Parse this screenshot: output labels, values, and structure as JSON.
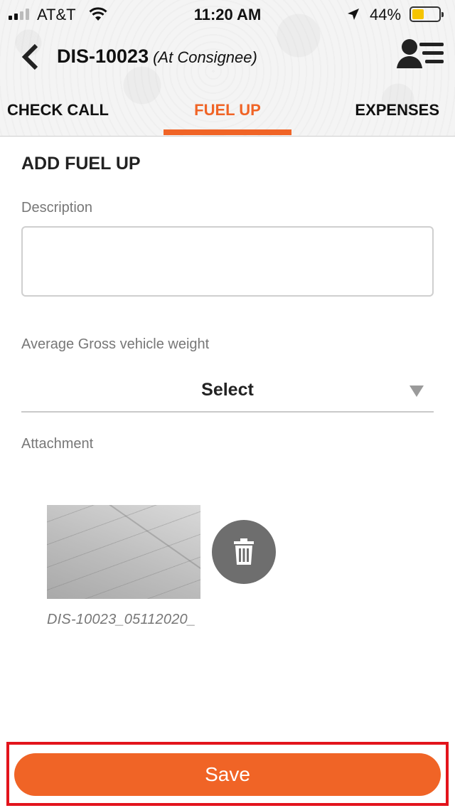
{
  "status_bar": {
    "carrier": "AT&T",
    "time": "11:20 AM",
    "battery_percent": "44%",
    "battery_level": 0.44,
    "battery_color": "#f5c400"
  },
  "nav": {
    "title": "DIS-10023",
    "subtitle": "(At Consignee)",
    "back_icon": "chevron-left-icon",
    "profile_icon": "user-list-icon"
  },
  "tabs": [
    {
      "label": "CHECK CALL",
      "active": false
    },
    {
      "label": "FUEL UP",
      "active": true
    },
    {
      "label": "EXPENSES",
      "active": false
    }
  ],
  "form": {
    "section_title": "ADD FUEL UP",
    "description": {
      "label": "Description",
      "value": "",
      "placeholder": ""
    },
    "weight": {
      "label": "Average Gross vehicle weight",
      "selected": "Select"
    },
    "attachment": {
      "label": "Attachment",
      "file_name": "DIS-10023_05112020_",
      "delete_icon": "trash-icon"
    }
  },
  "actions": {
    "save_label": "Save"
  },
  "colors": {
    "accent": "#f06426",
    "highlight_frame": "#e3141c",
    "delete_button": "#6e6e6e"
  }
}
